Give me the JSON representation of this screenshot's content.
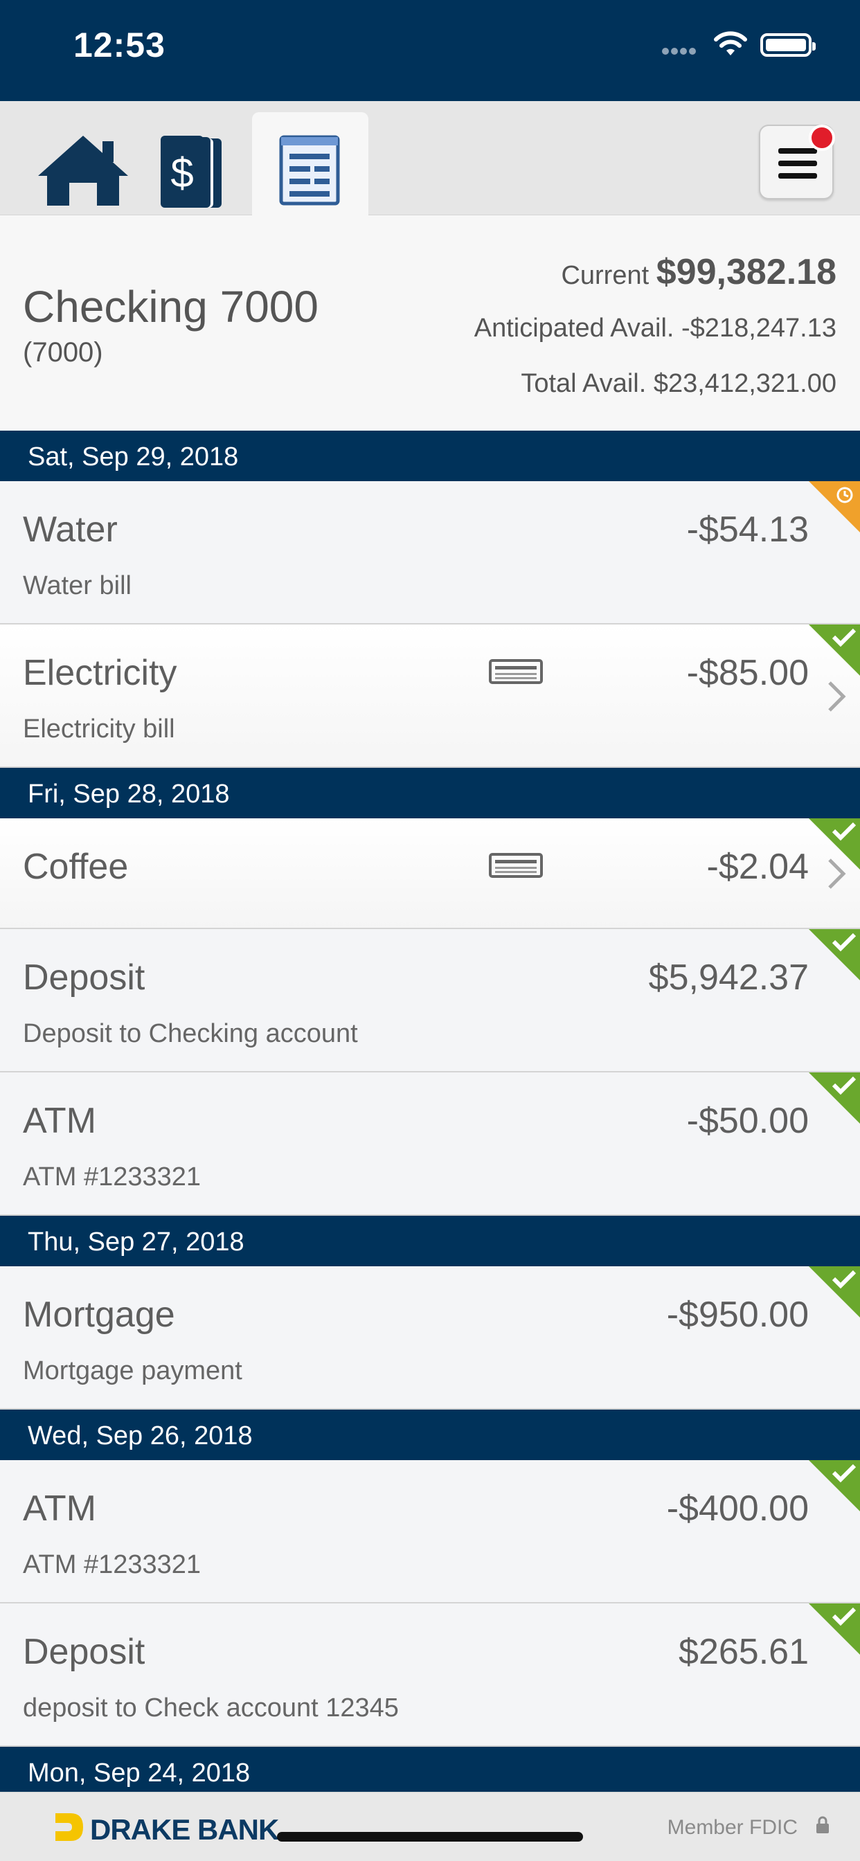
{
  "status_bar": {
    "time": "12:53"
  },
  "nav": {
    "tabs": [
      {
        "icon": "home-icon",
        "active": false
      },
      {
        "icon": "accounts-dollar-icon",
        "active": false
      },
      {
        "icon": "register-list-icon",
        "active": true
      }
    ],
    "menu": {
      "icon": "hamburger-menu-icon",
      "has_notification": true
    }
  },
  "account": {
    "name": "Checking 7000",
    "number": "(7000)",
    "current_label": "Current",
    "current_amount": "$99,382.18",
    "anticipated": "Anticipated Avail. -$218,247.13",
    "total": "Total Avail. $23,412,321.00"
  },
  "groups": [
    {
      "date": "Sat, Sep 29, 2018",
      "transactions": [
        {
          "title": "Water",
          "description": "Water bill",
          "amount": "-$54.13",
          "status": "pending",
          "card": false,
          "chevron": false
        },
        {
          "title": "Electricity",
          "description": "Electricity bill",
          "amount": "-$85.00",
          "status": "cleared",
          "card": true,
          "chevron": true
        }
      ]
    },
    {
      "date": "Fri, Sep 28, 2018",
      "transactions": [
        {
          "title": "Coffee",
          "description": "",
          "amount": "-$2.04",
          "status": "cleared",
          "card": true,
          "chevron": true
        },
        {
          "title": "Deposit",
          "description": "Deposit to Checking account",
          "amount": "$5,942.37",
          "status": "cleared",
          "card": false,
          "chevron": false
        },
        {
          "title": "ATM",
          "description": "ATM #1233321",
          "amount": "-$50.00",
          "status": "cleared",
          "card": false,
          "chevron": false
        }
      ]
    },
    {
      "date": "Thu, Sep 27, 2018",
      "transactions": [
        {
          "title": "Mortgage",
          "description": "Mortgage payment",
          "amount": "-$950.00",
          "status": "cleared",
          "card": false,
          "chevron": false
        }
      ]
    },
    {
      "date": "Wed, Sep 26, 2018",
      "transactions": [
        {
          "title": "ATM",
          "description": "ATM #1233321",
          "amount": "-$400.00",
          "status": "cleared",
          "card": false,
          "chevron": false
        },
        {
          "title": "Deposit",
          "description": "deposit to Check account 12345",
          "amount": "$265.61",
          "status": "cleared",
          "card": false,
          "chevron": false
        }
      ]
    },
    {
      "date": "Mon, Sep 24, 2018",
      "transactions": []
    }
  ],
  "footer": {
    "brand": "DRAKE BANK",
    "fdic": "Member FDIC"
  },
  "colors": {
    "navy": "#00325a",
    "cleared_green": "#6aa82d",
    "pending_orange": "#f0a12b",
    "badge_red": "#e11d2a"
  }
}
